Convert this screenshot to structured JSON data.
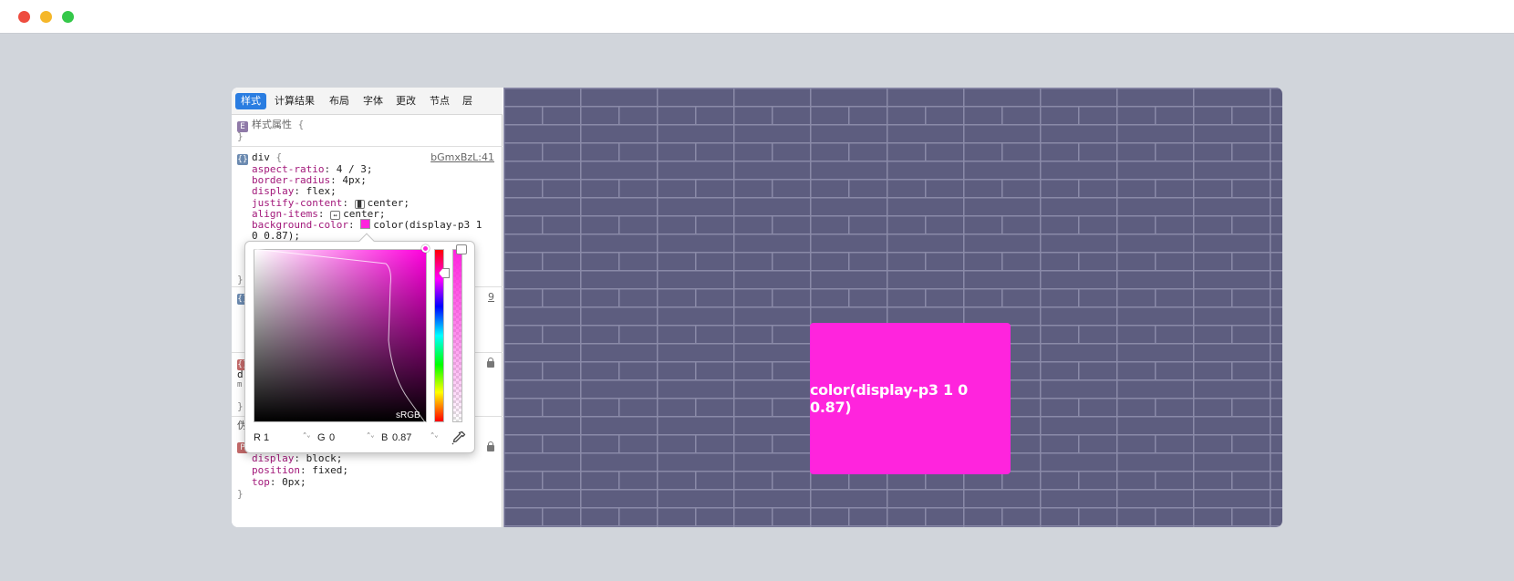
{
  "tabs": [
    "样式",
    "计算结果",
    "布局",
    "字体",
    "更改",
    "节点",
    "层"
  ],
  "style_attr_rule": {
    "badge": "E",
    "selector": "样式属性",
    "open": "{",
    "close": "}"
  },
  "div_rule": {
    "badge": "{}",
    "selector": "div",
    "open": "{",
    "source": "bGmxBzL:41",
    "close": "}",
    "props": [
      {
        "name": "aspect-ratio",
        "value": "4 / 3;"
      },
      {
        "name": "border-radius",
        "value": "4px;"
      },
      {
        "name": "display",
        "value": "flex;"
      },
      {
        "name": "justify-content",
        "value": "center;"
      },
      {
        "name": "align-items",
        "value": "center;"
      },
      {
        "name": "background-color",
        "value": "color(display-p3 1"
      }
    ],
    "value_continuation": "0 0.87);"
  },
  "partial_rules": {
    "second_source_fragment": "9",
    "third_badge": "{}",
    "third_line1": "d",
    "third_line2": "m",
    "close": "}",
    "pseudo_header": "伪",
    "fourth_badge": "P"
  },
  "last_rule_props": [
    {
      "name": "display",
      "value": "block;"
    },
    {
      "name": "position",
      "value": "fixed;"
    },
    {
      "name": "top",
      "value": "0px;"
    }
  ],
  "last_rule_close": "}",
  "color_picker": {
    "gamut_label": "sRGB",
    "r_label": "R",
    "r_value": "1",
    "g_label": "G",
    "g_value": "0",
    "b_label": "B",
    "b_value": "0.87",
    "stepper_glyph": "⌃⌄"
  },
  "preview": {
    "label": "color(display-p3 1 0 0.87)"
  },
  "colors": {
    "demo_box": "#ff24dd",
    "brick": "#5d5d7f",
    "mortar": "#8a8aa8",
    "active_tab": "#2a7de1"
  },
  "icons": {
    "justify_content": "justify-content-icon",
    "align_items": "align-items-icon",
    "eyedropper": "eyedropper-icon"
  }
}
